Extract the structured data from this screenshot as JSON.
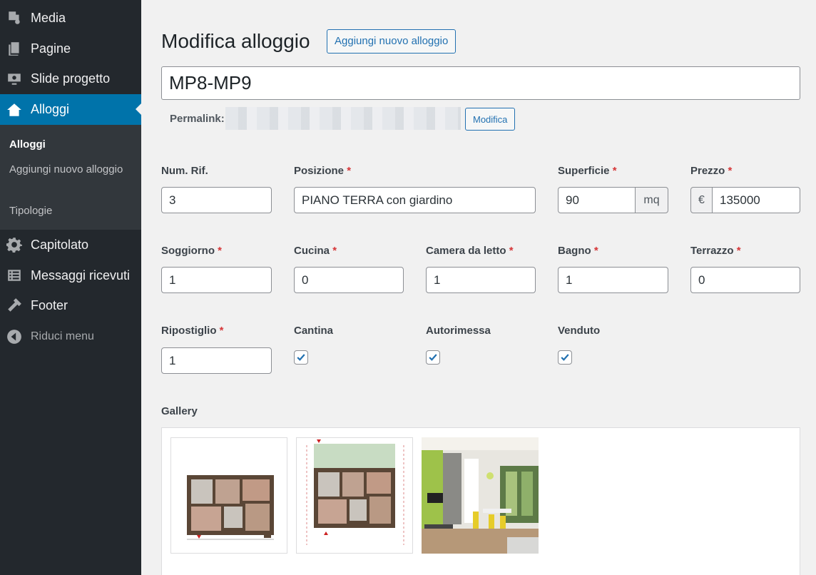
{
  "sidebar": {
    "items": [
      {
        "label": "Media",
        "icon": "media-icon"
      },
      {
        "label": "Pagine",
        "icon": "pages-icon"
      },
      {
        "label": "Slide progetto",
        "icon": "slides-icon"
      },
      {
        "label": "Alloggi",
        "icon": "houses-icon"
      },
      {
        "label": "Capitolato",
        "icon": "gear-icon"
      },
      {
        "label": "Messaggi ricevuti",
        "icon": "list-icon"
      },
      {
        "label": "Footer",
        "icon": "hammer-icon"
      }
    ],
    "submenu": [
      "Alloggi",
      "Aggiungi nuovo alloggio",
      "Tipologie"
    ],
    "collapse_label": "Riduci menu"
  },
  "header": {
    "title": "Modifica alloggio",
    "add_new_label": "Aggiungi nuovo alloggio"
  },
  "post": {
    "title_value": "MP8-MP9",
    "permalink_label": "Permalink:",
    "permalink_edit_label": "Modifica"
  },
  "fields": {
    "num_rif": {
      "label": "Num. Rif.",
      "value": "3"
    },
    "posizione": {
      "label": "Posizione",
      "value": "PIANO TERRA con giardino"
    },
    "superficie": {
      "label": "Superficie",
      "value": "90",
      "unit": "mq"
    },
    "prezzo": {
      "label": "Prezzo",
      "value": "135000",
      "currency": "€"
    },
    "soggiorno": {
      "label": "Soggiorno",
      "value": "1"
    },
    "cucina": {
      "label": "Cucina",
      "value": "0"
    },
    "camera": {
      "label": "Camera da letto",
      "value": "1"
    },
    "bagno": {
      "label": "Bagno",
      "value": "1"
    },
    "terrazzo": {
      "label": "Terrazzo",
      "value": "0"
    },
    "ripostiglio": {
      "label": "Ripostiglio",
      "value": "1"
    },
    "cantina": {
      "label": "Cantina",
      "checked": true
    },
    "autorimessa": {
      "label": "Autorimessa",
      "checked": true
    },
    "venduto": {
      "label": "Venduto",
      "checked": true
    },
    "required_mark": "*"
  },
  "gallery": {
    "label": "Gallery",
    "images": [
      "floorplan-image",
      "floorplan-garden-image",
      "living-room-render-image"
    ]
  },
  "colors": {
    "sidebar_bg": "#23282d",
    "active": "#0073aa",
    "link": "#2271b1",
    "required": "#d63638"
  }
}
